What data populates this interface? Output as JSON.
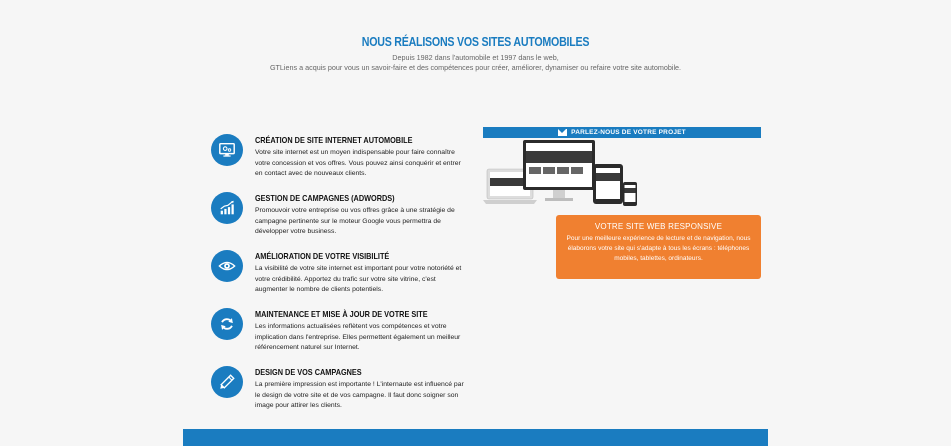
{
  "hero": {
    "title": "NOUS RÉALISONS VOS SITES AUTOMOBILES",
    "subtitle_line1": "Depuis 1982 dans l'automobile et 1997 dans le web,",
    "subtitle_line2": "GTLiens a acquis pour vous un savoir-faire et des compétences pour créer, améliorer, dynamiser ou refaire votre site automobile."
  },
  "features": [
    {
      "icon": "monitor-gear-icon",
      "title": "CRÉATION DE SITE INTERNET AUTOMOBILE",
      "text": "Votre site internet est un moyen indispensable pour faire connaître votre concession et vos offres. Vous pouvez ainsi conquérir et entrer en contact avec de nouveaux clients."
    },
    {
      "icon": "bar-chart-growth-icon",
      "title": "GESTION DE CAMPAGNES (ADWORDS)",
      "text": "Promouvoir votre entreprise ou vos offres grâce à une stratégie de campagne pertinente sur le moteur Google vous permettra de développer votre business."
    },
    {
      "icon": "eye-icon",
      "title": "AMÉLIORATION DE VOTRE VISIBILITÉ",
      "text": "La visibilité de votre site internet est important pour votre notoriété et votre crédibilité. Apportez du trafic sur votre site vitrine, c'est augmenter le nombre de clients potentiels."
    },
    {
      "icon": "refresh-icon",
      "title": "MAINTENANCE ET MISE À JOUR DE VOTRE SITE",
      "text": "Les informations actualisées reflètent vos compétences et votre implication dans l'entreprise. Elles permettent également un meilleur référencement naturel sur Internet."
    },
    {
      "icon": "pencil-icon",
      "title": "DESIGN DE VOS CAMPAGNES",
      "text": "La première impression est importante ! L'internaute est influencé par le design de votre site et de vos campagne. Il faut donc soigner son image pour attirer les clients."
    }
  ],
  "contact_bar": {
    "icon": "envelope-icon",
    "label": "PARLEZ-NOUS DE VOTRE PROJET"
  },
  "responsive_box": {
    "title": "VOTRE SITE WEB RESPONSIVE",
    "text": "Pour une meilleure expérience de lecture et de navigation, nous élaborons votre site qui s'adapte à tous les écrans : téléphones mobiles, tablettes, ordinateurs."
  },
  "colors": {
    "brand_blue": "#1a7cc0",
    "accent_orange": "#f08030",
    "background": "#f6f6f6"
  }
}
